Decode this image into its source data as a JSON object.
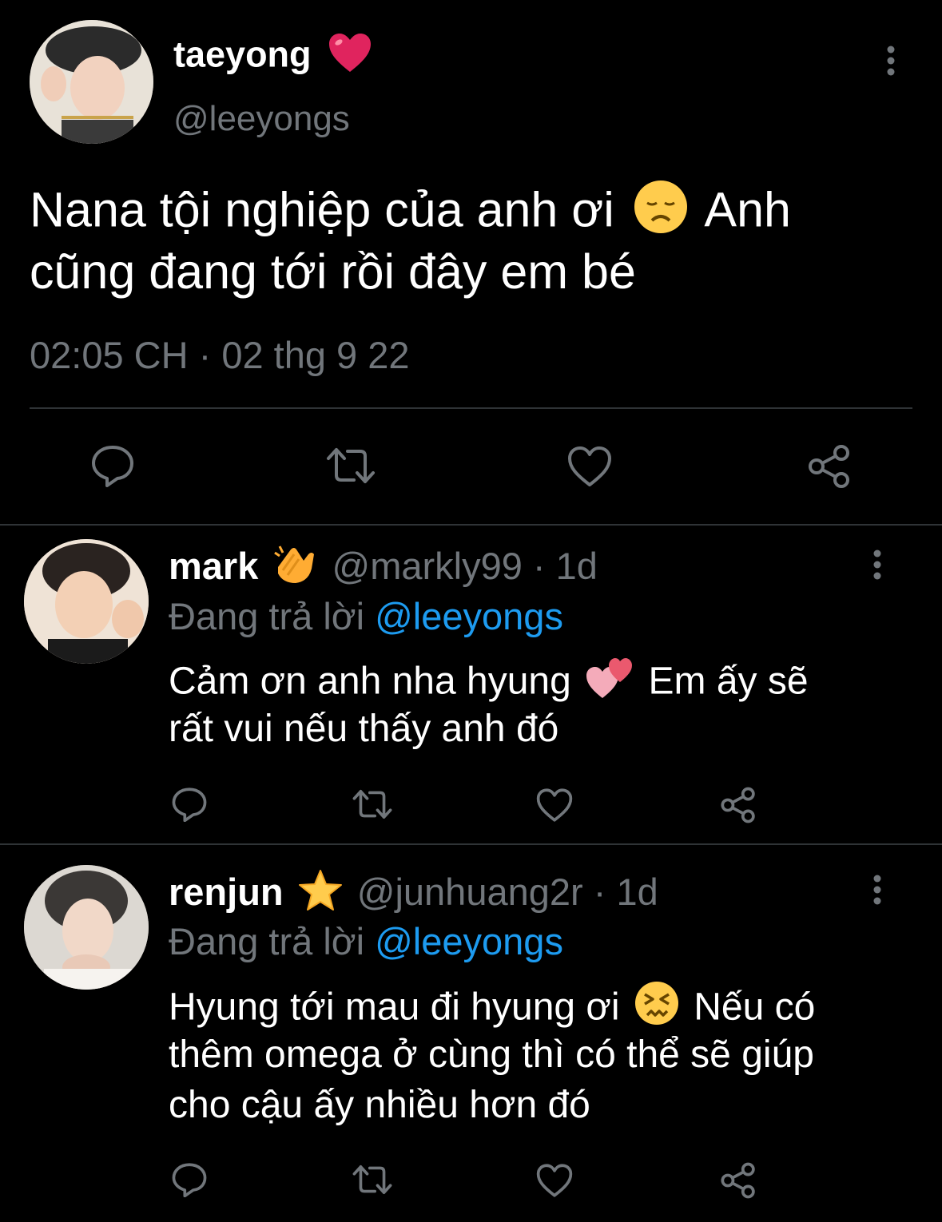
{
  "main_tweet": {
    "display_name": "taeyong",
    "name_emoji": "heart-emoji",
    "handle": "@leeyongs",
    "text_line1_a": "Nana tội nghiệp của anh ơi",
    "text_line1_b": "Anh",
    "text_emoji": "disappointed-face-emoji",
    "text_line2": "cũng đang tới rồi đây em bé",
    "timestamp": "02:05 CH · 02 thg 9 22"
  },
  "replies": [
    {
      "display_name": "mark",
      "name_emoji": "clapping-hands-emoji",
      "handle": "@markly99",
      "time": "· 1d",
      "replying_prefix": "Đang trả lời",
      "replying_to": "@leeyongs",
      "line1_a": "Cảm ơn anh nha hyung",
      "line1_b": "Em ấy sẽ",
      "line2": "rất vui nếu thấy anh đó"
    },
    {
      "display_name": "renjun",
      "name_emoji": "star-emoji",
      "handle": "@junhuang2r",
      "time": "· 1d",
      "replying_prefix": "Đang trả lời",
      "replying_to": "@leeyongs",
      "line1_a": "Hyung tới mau đi hyung ơi",
      "line1_b": "Nếu có",
      "line2": "thêm omega ở cùng thì có thể sẽ giúp",
      "line3": "cho cậu ấy nhiều hơn đó"
    }
  ],
  "colors": {
    "background": "#000000",
    "text": "#ffffff",
    "muted": "#71767b",
    "link": "#1d9bf0",
    "divider": "#2f3336"
  }
}
